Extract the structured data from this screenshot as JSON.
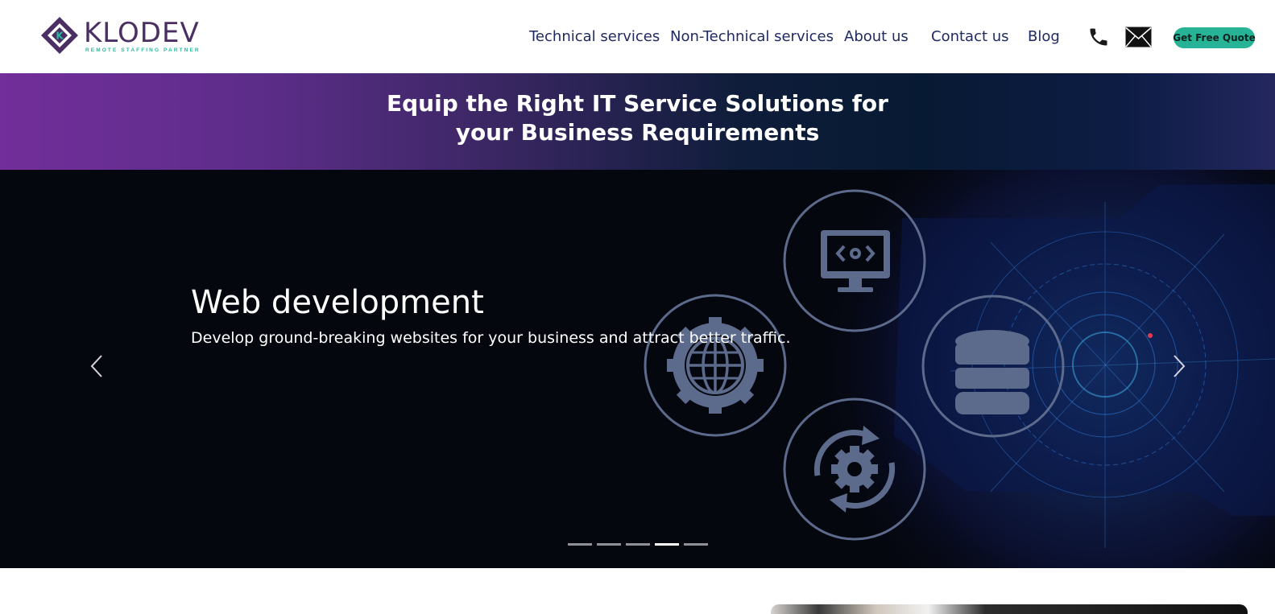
{
  "header": {
    "logo": {
      "wordmark": "KLODEV",
      "tagline": "REMOTE STAFFING PARTNER",
      "mark_letter": "K"
    },
    "nav": [
      {
        "label": "Technical services"
      },
      {
        "label": "Non-Technical services"
      },
      {
        "label": "About us"
      },
      {
        "label": "Contact us"
      },
      {
        "label": "Blog"
      }
    ],
    "icons": {
      "phone": "phone-icon",
      "mail": "mail-icon"
    },
    "quote_button": "Get Free Quote",
    "colors": {
      "brand": "#4b2f63",
      "accent": "#26b396",
      "nav_text": "#1f2a60"
    }
  },
  "banner": {
    "line1": "Equip the Right IT Service Solutions for",
    "line2": "your Business Requirements"
  },
  "hero": {
    "slide_title": "Web development",
    "slide_subtitle": "Develop ground-breaking websites for your business and attract better traffic.",
    "prev_icon": "chevron-left-icon",
    "next_icon": "chevron-right-icon",
    "slide_count": 5,
    "active_slide": 4,
    "illustration_icons": [
      "monitor-code-icon",
      "globe-gear-icon",
      "database-icon",
      "gear-sync-icon"
    ]
  }
}
